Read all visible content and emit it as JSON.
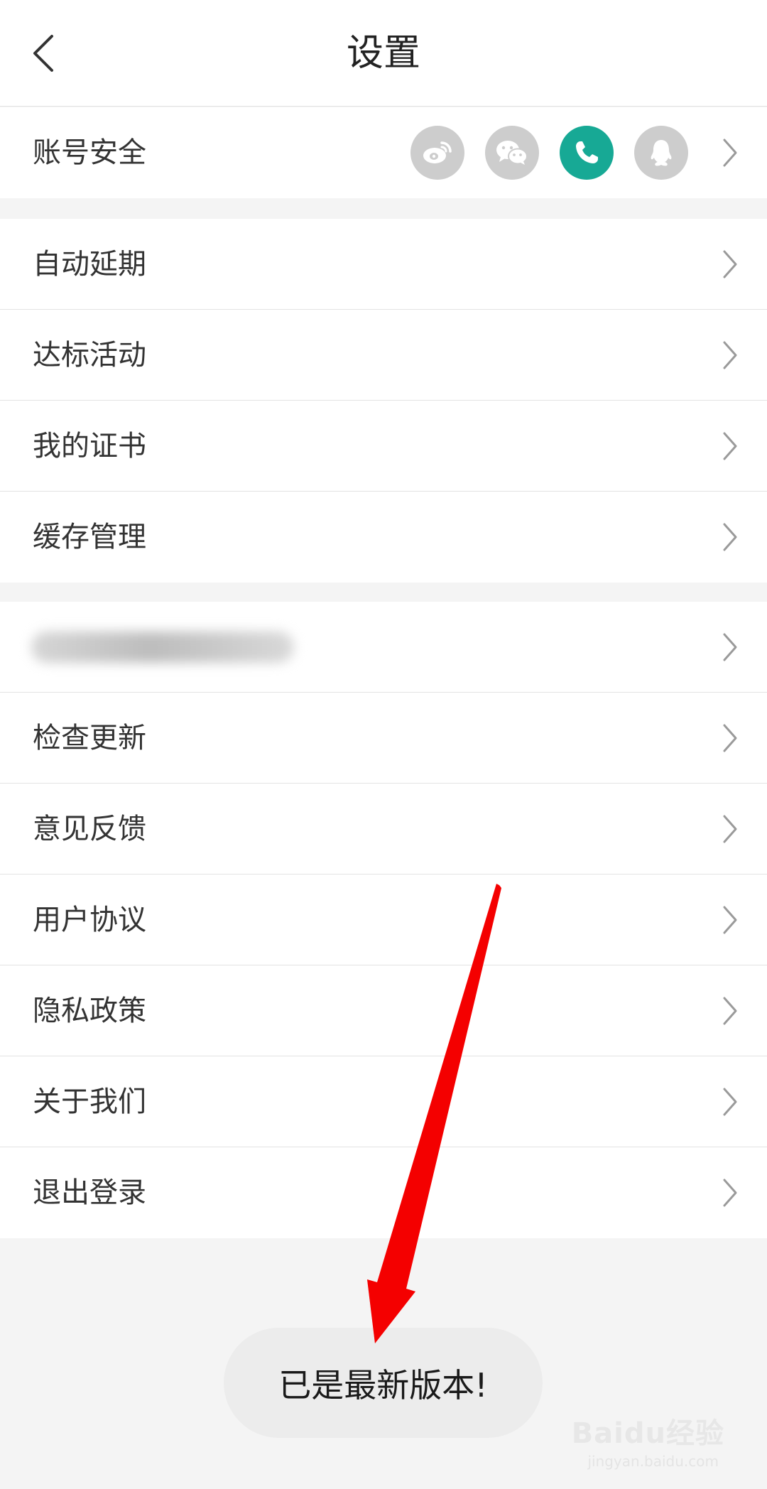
{
  "header": {
    "title": "设置",
    "back_icon": "chevron-left-icon"
  },
  "account": {
    "label": "账号安全",
    "linked": [
      {
        "name": "weibo-icon",
        "active": false
      },
      {
        "name": "wechat-icon",
        "active": false
      },
      {
        "name": "phone-icon",
        "active": true
      },
      {
        "name": "qq-icon",
        "active": false
      }
    ]
  },
  "group1": [
    "自动延期",
    "达标活动",
    "我的证书",
    "缓存管理"
  ],
  "group2": [
    "检查更新",
    "意见反馈",
    "用户协议",
    "隐私政策",
    "关于我们",
    "退出登录"
  ],
  "toast": {
    "text": "已是最新版本!"
  },
  "watermark": {
    "logo": "Baidu经验",
    "url": "jingyan.baidu.com"
  },
  "colors": {
    "accent": "#17a995",
    "icon_gray": "#cdcdcd",
    "arrow": "#ff0000"
  }
}
